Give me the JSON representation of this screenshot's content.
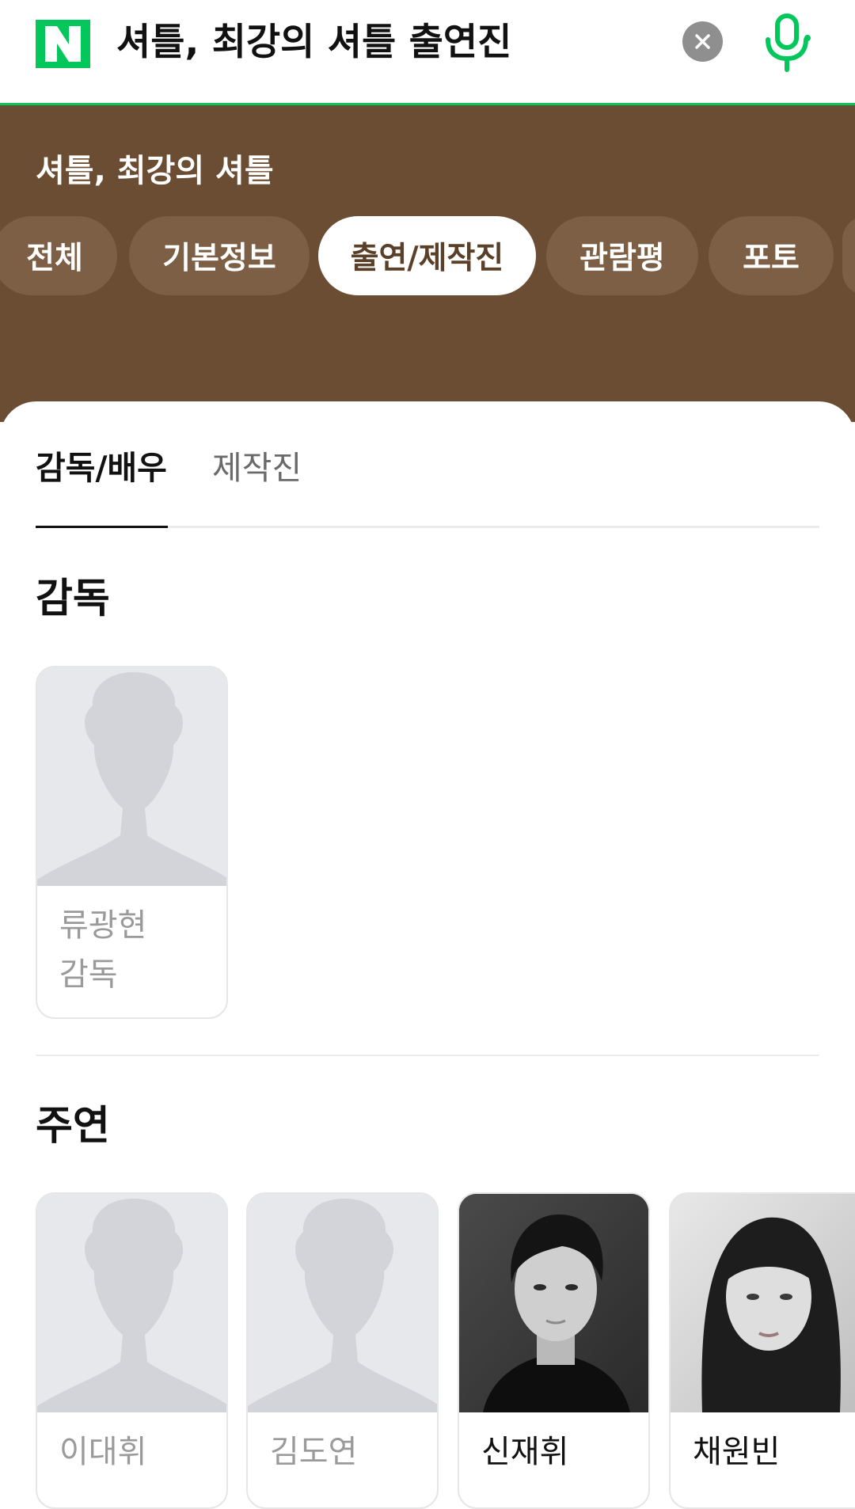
{
  "search": {
    "query": "셔틀, 최강의 셔틀 출연진",
    "logo_letter": "N"
  },
  "colors": {
    "brand_green": "#03c75a",
    "header_brown": "#6b4d33",
    "pill_brown": "#7c5f45"
  },
  "header": {
    "movie_title": "셔틀, 최강의 셔틀",
    "tabs": [
      {
        "label": "전체"
      },
      {
        "label": "기본정보"
      },
      {
        "label": "출연/제작진",
        "active": true
      },
      {
        "label": "관람평"
      },
      {
        "label": "포토"
      }
    ]
  },
  "subtabs": [
    {
      "label": "감독/배우",
      "active": true
    },
    {
      "label": "제작진"
    }
  ],
  "director_section": {
    "title": "감독",
    "people": [
      {
        "name": "류광현",
        "role": "감독",
        "photo": "placeholder-silhouette"
      }
    ]
  },
  "cast_section": {
    "title": "주연",
    "people": [
      {
        "name": "이대휘",
        "photo": "placeholder-silhouette"
      },
      {
        "name": "김도연",
        "photo": "placeholder-silhouette"
      },
      {
        "name": "신재휘",
        "photo": "bw-portrait-male"
      },
      {
        "name": "채원빈",
        "photo": "bw-portrait-female"
      }
    ]
  }
}
